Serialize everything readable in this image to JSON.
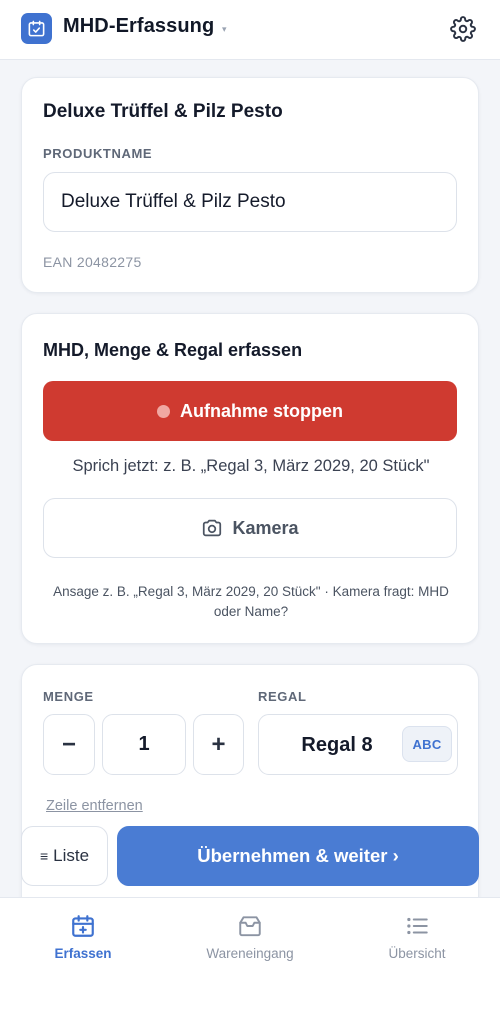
{
  "header": {
    "app_title": "MHD-Erfassung",
    "caret": "▾",
    "logo_icon": "calendar-check-icon",
    "settings_icon": "gear-icon"
  },
  "product_card": {
    "title": "Deluxe Trüffel & Pilz Pesto",
    "name_label": "PRODUKTNAME",
    "name_value": "Deluxe Trüffel & Pilz Pesto",
    "ean": "EAN 20482275"
  },
  "capture_card": {
    "title": "MHD, Menge & Regal erfassen",
    "record_button": "Aufnahme stoppen",
    "prompt": "Sprich jetzt: z. B. „Regal 3, März 2029, 20 Stück\"",
    "camera_button": "Kamera",
    "hint": "Ansage z. B. „Regal 3, März 2029, 20 Stück\" · Kamera fragt: MHD oder Name?"
  },
  "line_card": {
    "quantity_label": "MENGE",
    "shelf_label": "REGAL",
    "minus": "−",
    "quantity": "1",
    "plus": "+",
    "shelf_value": "Regal 8",
    "abc_button": "ABC",
    "remove_line": "Zeile entfernen"
  },
  "actions": {
    "list_button": "Liste",
    "list_icon": "≡",
    "accept_button": "Übernehmen & weiter ›"
  },
  "tabs": [
    {
      "label": "Erfassen",
      "icon": "calendar-plus-icon",
      "active": true
    },
    {
      "label": "Wareneingang",
      "icon": "package-icon",
      "active": false
    },
    {
      "label": "Übersicht",
      "icon": "list-icon",
      "active": false
    }
  ],
  "colors": {
    "accent": "#3f72d0",
    "record_red": "#cf3a30",
    "primary_button": "#4a7cd3"
  }
}
